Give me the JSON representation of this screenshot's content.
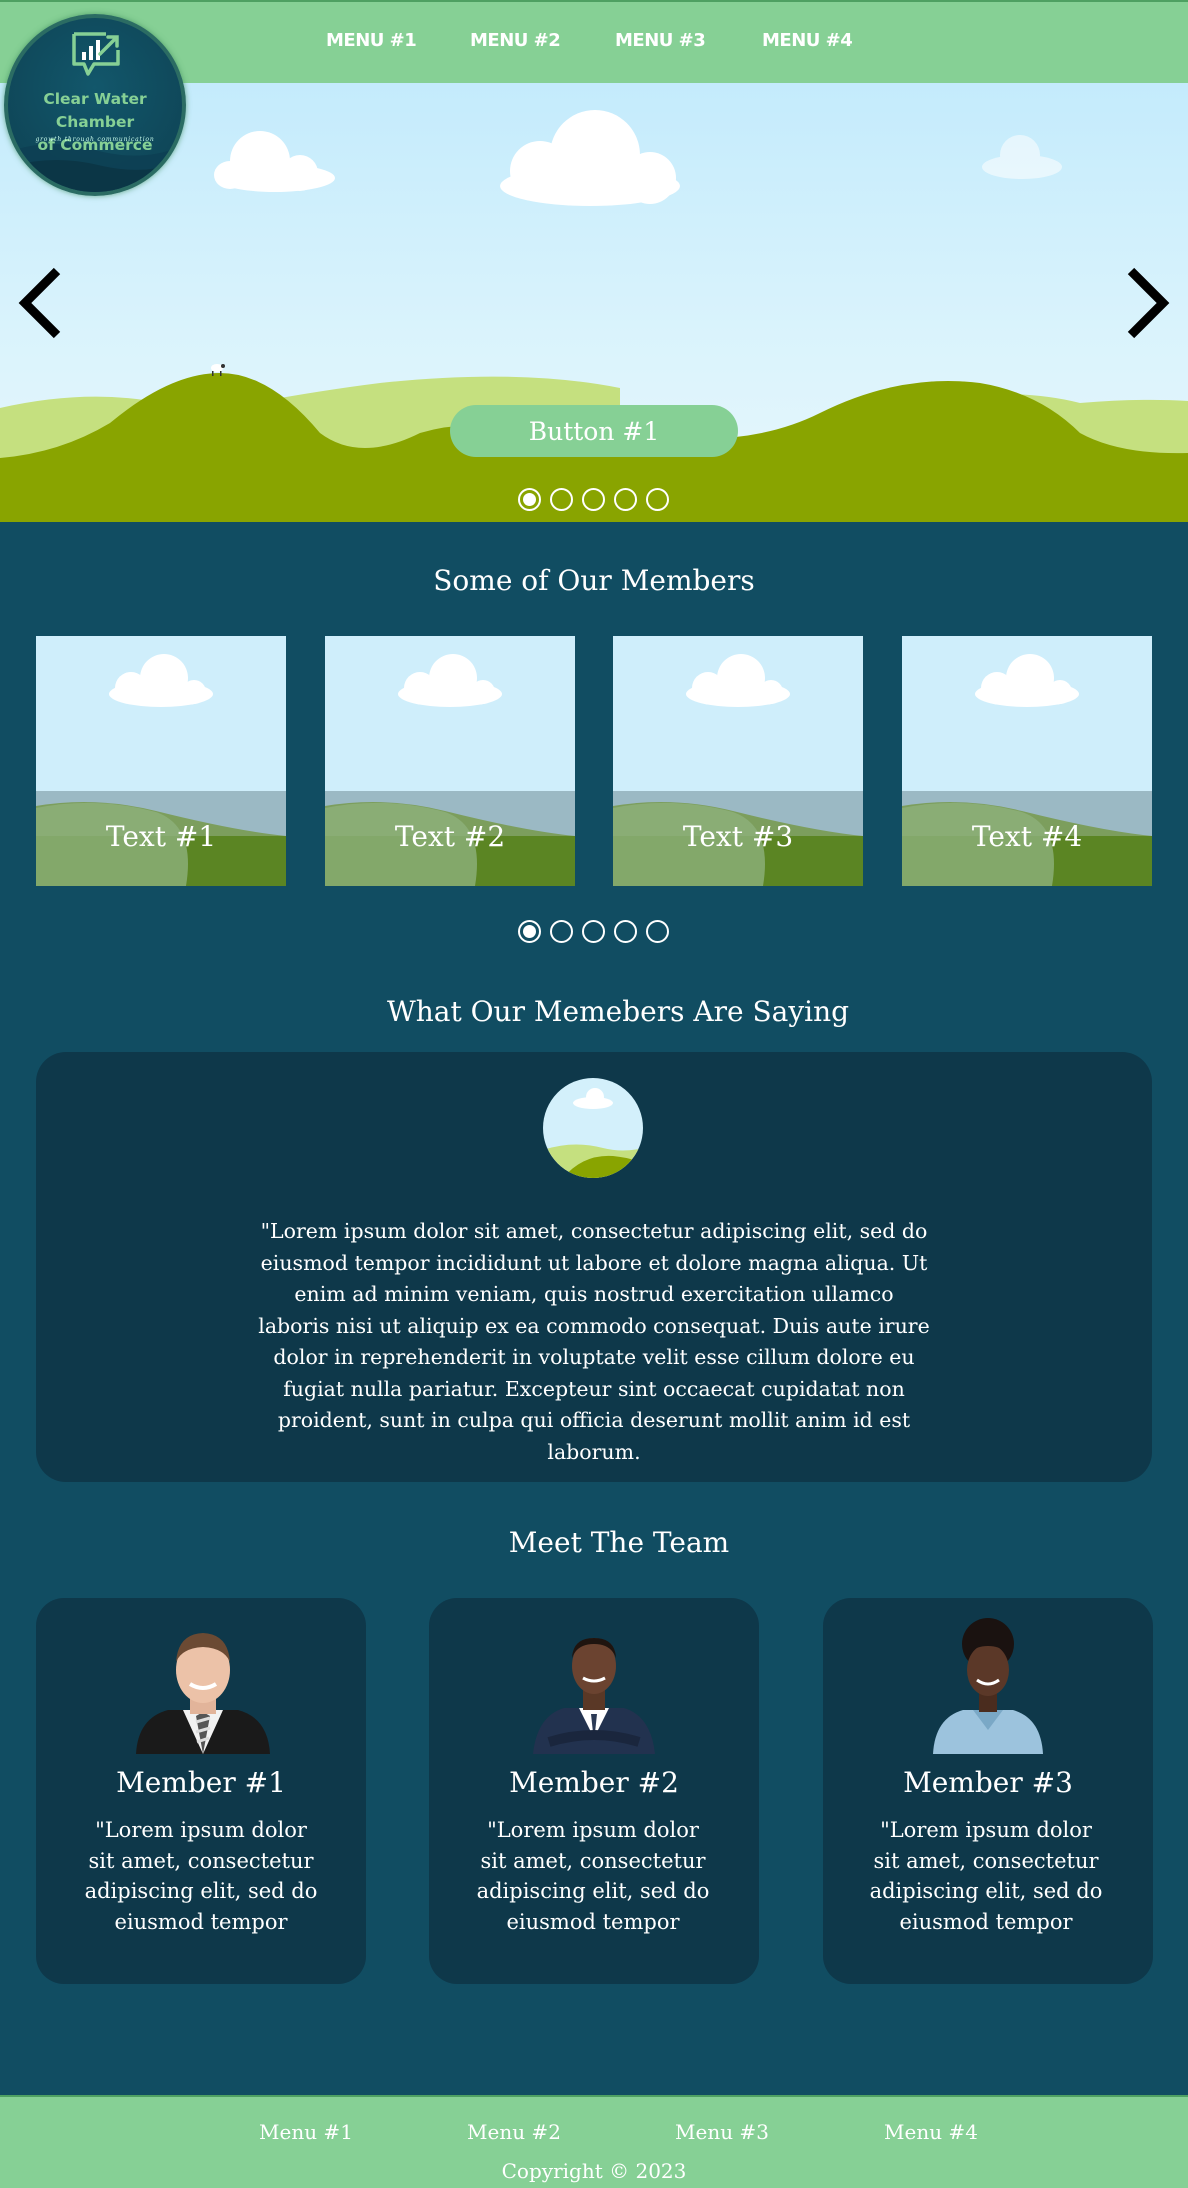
{
  "logo": {
    "line1": "Clear Water Chamber",
    "line2": "of Commerce",
    "tagline": "growth through communication"
  },
  "nav": [
    "MENU #1",
    "MENU #2",
    "MENU #3",
    "MENU #4"
  ],
  "hero": {
    "button_label": "Button #1",
    "slide_count": 5,
    "active_slide": 1
  },
  "members": {
    "title": "Some of Our Members",
    "cards": [
      "Text #1",
      "Text #2",
      "Text #3",
      "Text #4"
    ],
    "slide_count": 5,
    "active_slide": 1
  },
  "testimonials": {
    "title": "What Our Memebers Are Saying",
    "quote": "\"Lorem ipsum dolor sit amet, consectetur adipiscing elit, sed do eiusmod tempor incididunt ut labore et dolore magna aliqua. Ut enim ad minim veniam, quis nostrud exercitation ullamco laboris nisi ut aliquip ex ea commodo consequat. Duis aute irure dolor in reprehenderit in voluptate velit esse cillum dolore eu fugiat nulla pariatur. Excepteur sint occaecat cupidatat non proident, sunt in culpa qui officia deserunt mollit anim id est laborum."
  },
  "team": {
    "title": "Meet The Team",
    "members": [
      {
        "name": "Member #1",
        "text": "\"Lorem ipsum dolor sit amet, consectetur adipiscing elit, sed do eiusmod tempor"
      },
      {
        "name": "Member #2",
        "text": "\"Lorem ipsum dolor sit amet, consectetur adipiscing elit, sed do eiusmod tempor"
      },
      {
        "name": "Member #3",
        "text": "\"Lorem ipsum dolor sit amet, consectetur adipiscing elit, sed do eiusmod tempor"
      }
    ]
  },
  "footer": {
    "links": [
      "Menu #1",
      "Menu #2",
      "Menu #3",
      "Menu #4"
    ],
    "copyright": "Copyright © 2023"
  },
  "colors": {
    "accent_green": "#86d095",
    "page_bg": "#114d62",
    "card_bg": "#0e384a",
    "grass": "#89a400"
  }
}
